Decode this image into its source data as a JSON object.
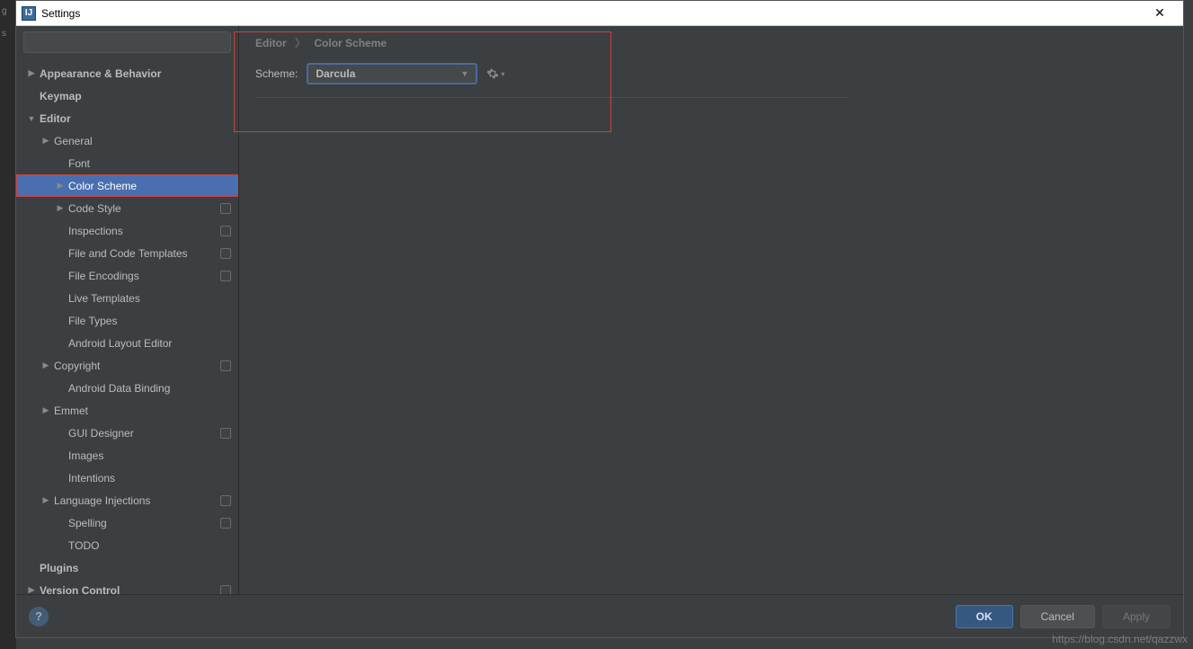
{
  "window": {
    "title": "Settings"
  },
  "search": {
    "placeholder": ""
  },
  "sidebar": {
    "items": [
      {
        "label": "Appearance & Behavior",
        "arrow": "right",
        "level": 0,
        "bold": true
      },
      {
        "label": "Keymap",
        "arrow": "none",
        "level": 0,
        "bold": true
      },
      {
        "label": "Editor",
        "arrow": "down",
        "level": 0,
        "bold": true
      },
      {
        "label": "General",
        "arrow": "right",
        "level": 1
      },
      {
        "label": "Font",
        "arrow": "none",
        "level": 2
      },
      {
        "label": "Color Scheme",
        "arrow": "right",
        "level": 2,
        "selected": true,
        "border": true
      },
      {
        "label": "Code Style",
        "arrow": "right",
        "level": 2,
        "badge": true
      },
      {
        "label": "Inspections",
        "arrow": "none",
        "level": 2,
        "badge": true
      },
      {
        "label": "File and Code Templates",
        "arrow": "none",
        "level": 2,
        "badge": true
      },
      {
        "label": "File Encodings",
        "arrow": "none",
        "level": 2,
        "badge": true
      },
      {
        "label": "Live Templates",
        "arrow": "none",
        "level": 2
      },
      {
        "label": "File Types",
        "arrow": "none",
        "level": 2
      },
      {
        "label": "Android Layout Editor",
        "arrow": "none",
        "level": 2
      },
      {
        "label": "Copyright",
        "arrow": "right",
        "level": 1,
        "badge": true
      },
      {
        "label": "Android Data Binding",
        "arrow": "none",
        "level": 2
      },
      {
        "label": "Emmet",
        "arrow": "right",
        "level": 1
      },
      {
        "label": "GUI Designer",
        "arrow": "none",
        "level": 2,
        "badge": true
      },
      {
        "label": "Images",
        "arrow": "none",
        "level": 2
      },
      {
        "label": "Intentions",
        "arrow": "none",
        "level": 2
      },
      {
        "label": "Language Injections",
        "arrow": "right",
        "level": 1,
        "badge": true
      },
      {
        "label": "Spelling",
        "arrow": "none",
        "level": 2,
        "badge": true
      },
      {
        "label": "TODO",
        "arrow": "none",
        "level": 2
      },
      {
        "label": "Plugins",
        "arrow": "none",
        "level": 0,
        "bold": true
      },
      {
        "label": "Version Control",
        "arrow": "right",
        "level": 0,
        "bold": true,
        "badge": true
      }
    ]
  },
  "breadcrumb": {
    "part1": "Editor",
    "sep": "〉",
    "part2": "Color Scheme"
  },
  "scheme": {
    "label": "Scheme:",
    "value": "Darcula"
  },
  "buttons": {
    "ok": "OK",
    "cancel": "Cancel",
    "apply": "Apply"
  },
  "watermark": "https://blog.csdn.net/qazzwx"
}
